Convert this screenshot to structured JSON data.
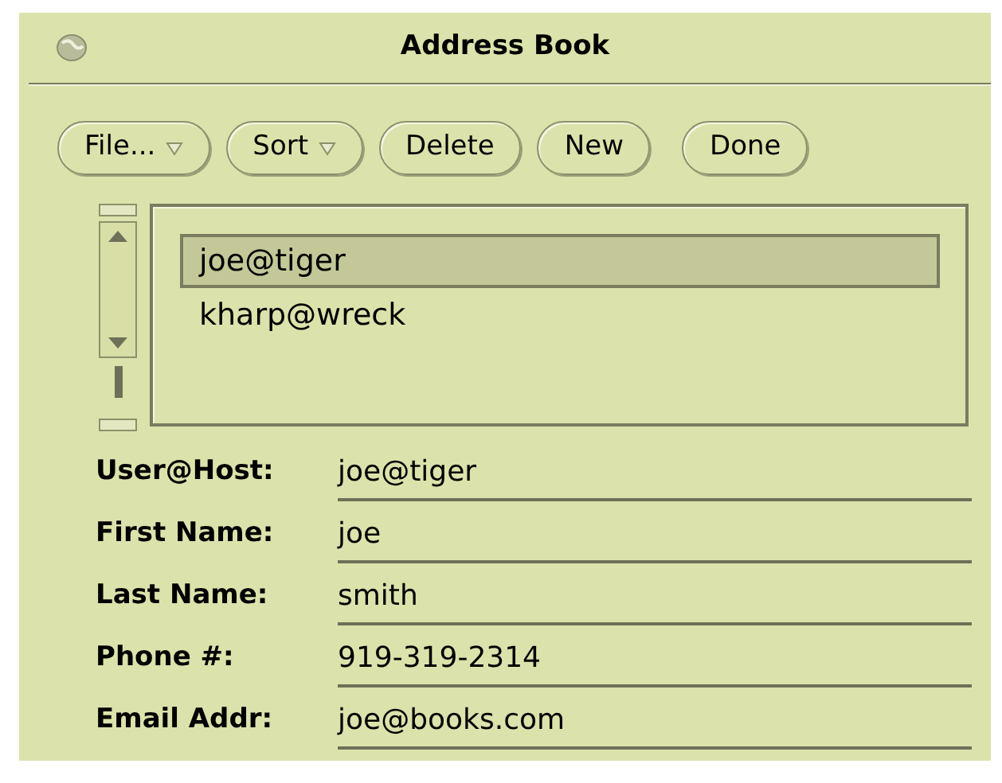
{
  "window": {
    "title": "Address Book"
  },
  "buttons": [
    {
      "label": "File...",
      "kind": "menu"
    },
    {
      "label": "Sort",
      "kind": "menu"
    },
    {
      "label": "Delete",
      "kind": "command"
    },
    {
      "label": "New",
      "kind": "command"
    },
    {
      "label": "Done",
      "kind": "command"
    }
  ],
  "list": {
    "items": [
      {
        "label": "joe@tiger",
        "selected": true
      },
      {
        "label": "kharp@wreck",
        "selected": false
      }
    ]
  },
  "fields": [
    {
      "label": "User@Host:",
      "value": "joe@tiger"
    },
    {
      "label": "First Name:",
      "value": "joe"
    },
    {
      "label": "Last Name:",
      "value": "smith"
    },
    {
      "label": "Phone #:",
      "value": "919-319-2314"
    },
    {
      "label": "Email Addr:",
      "value": "joe@books.com"
    }
  ]
}
